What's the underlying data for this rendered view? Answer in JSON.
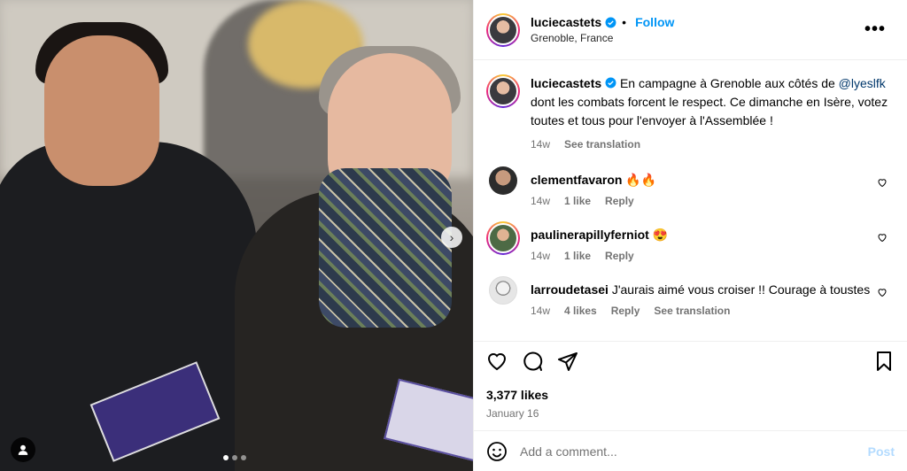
{
  "post": {
    "username": "luciecastets",
    "follow_label": "Follow",
    "location": "Grenoble, France",
    "more_label": "•••"
  },
  "caption": {
    "username": "luciecastets",
    "text_before": "En campagne à Grenoble aux côtés de ",
    "mention": "@lyeslfk",
    "text_after": " dont les combats forcent le respect. Ce dimanche en Isère, votez toutes et tous pour l'envoyer à l'Assemblée !",
    "time": "14w",
    "see_translation": "See translation"
  },
  "comments": [
    {
      "username": "clementfavaron",
      "text": "🔥🔥",
      "time": "14w",
      "likes": "1 like",
      "reply": "Reply",
      "avatar_color": "#3b3b3b"
    },
    {
      "username": "paulinerapillyferniot",
      "text": "😍",
      "time": "14w",
      "likes": "1 like",
      "reply": "Reply",
      "avatar_color": "#5d7a4f"
    },
    {
      "username": "larroudetasei",
      "text": "J'aurais aimé vous croiser !! Courage à toustes",
      "time": "14w",
      "likes": "4 likes",
      "reply": "Reply",
      "see_translation": "See translation",
      "avatar_color": "#d9d9d9"
    }
  ],
  "stats": {
    "likes": "3,377 likes",
    "date": "January 16"
  },
  "composer": {
    "placeholder": "Add a comment...",
    "post_label": "Post"
  },
  "media": {
    "next_glyph": "›",
    "carousel_dots": 3,
    "active_dot": 0
  },
  "colors": {
    "link": "#0095f6",
    "mention": "#00376b",
    "muted": "#737373"
  }
}
